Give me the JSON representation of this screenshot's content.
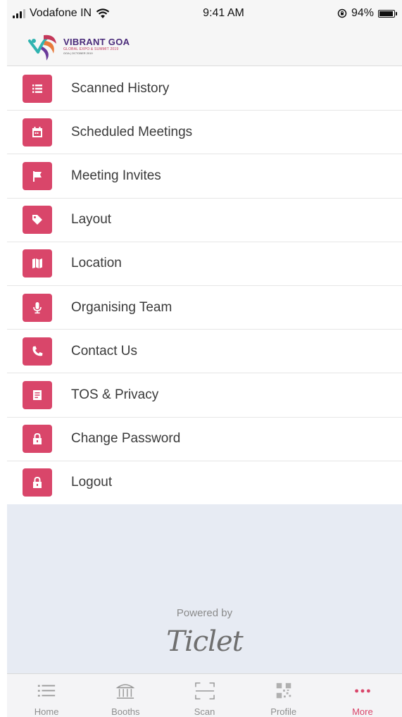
{
  "status_bar": {
    "carrier": "Vodafone IN",
    "time": "9:41 AM",
    "battery": "94%"
  },
  "header": {
    "logo_title": "VIBRANT GOA",
    "logo_subtitle": "GLOBAL EXPO & SUMMIT 2019",
    "logo_dates": "GOA | OCTOBER 2019"
  },
  "menu": [
    {
      "label": "Scanned History",
      "icon": "list-icon"
    },
    {
      "label": "Scheduled Meetings",
      "icon": "calendar-icon"
    },
    {
      "label": "Meeting Invites",
      "icon": "flag-icon"
    },
    {
      "label": "Layout",
      "icon": "tag-icon"
    },
    {
      "label": "Location",
      "icon": "map-icon"
    },
    {
      "label": "Organising Team",
      "icon": "microphone-icon"
    },
    {
      "label": "Contact Us",
      "icon": "phone-icon"
    },
    {
      "label": "TOS & Privacy",
      "icon": "document-icon"
    },
    {
      "label": "Change Password",
      "icon": "lock-icon"
    },
    {
      "label": "Logout",
      "icon": "lock-icon"
    }
  ],
  "footer": {
    "powered_by": "Powered by",
    "brand": "Ticlet"
  },
  "tabs": [
    {
      "label": "Home",
      "icon": "list-icon"
    },
    {
      "label": "Booths",
      "icon": "booth-icon"
    },
    {
      "label": "Scan",
      "icon": "scan-icon"
    },
    {
      "label": "Profile",
      "icon": "qr-icon"
    },
    {
      "label": "More",
      "icon": "more-dots-icon",
      "active": true
    }
  ],
  "colors": {
    "accent": "#d9466a",
    "background_area": "#e7ebf3"
  }
}
